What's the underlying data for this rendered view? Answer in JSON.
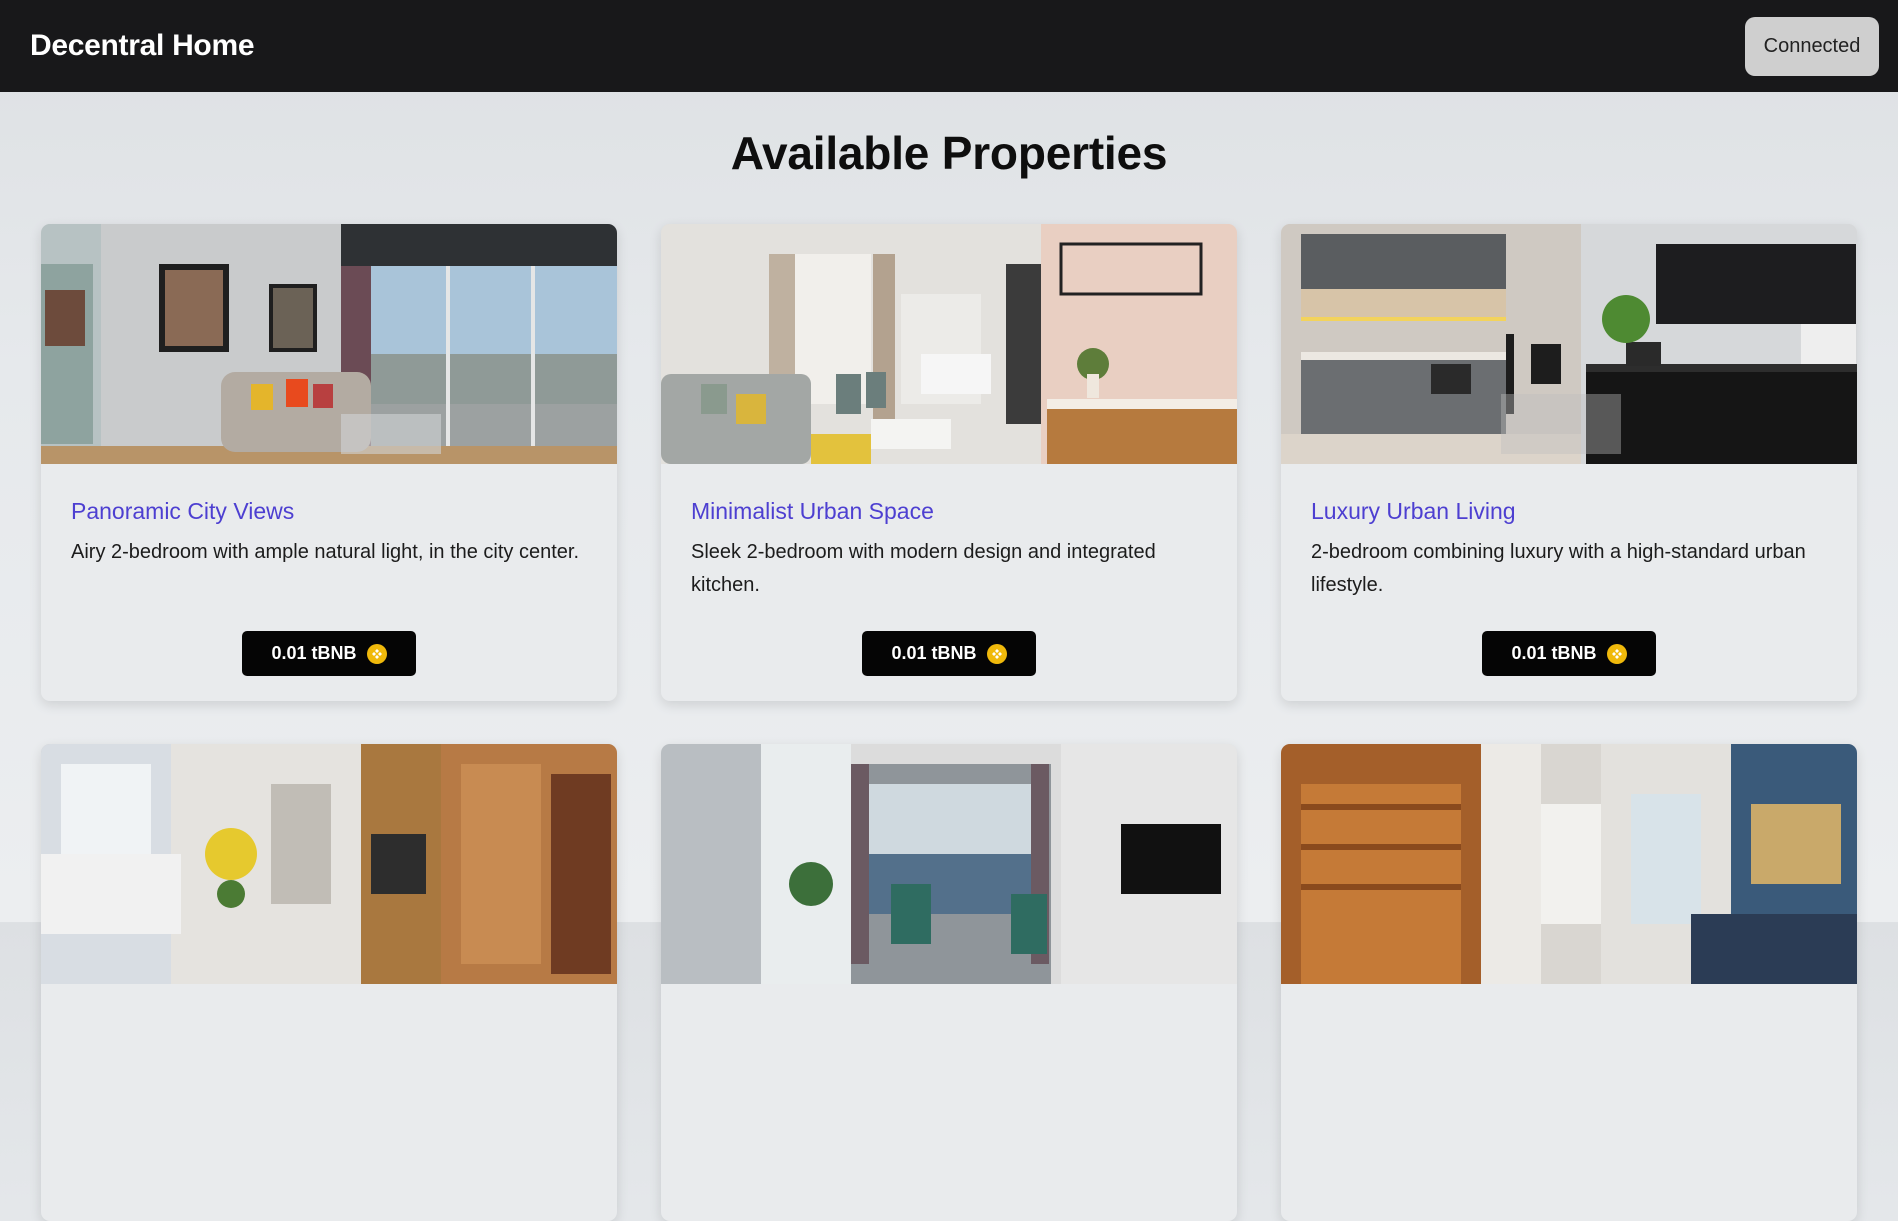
{
  "header": {
    "brand": "Decentral Home",
    "wallet_button": "Connected"
  },
  "main": {
    "title": "Available Properties"
  },
  "properties": [
    {
      "title": "Panoramic City Views",
      "description": "Airy 2-bedroom with ample natural light, in the city center.",
      "price": "0.01 tBNB",
      "image": "living-room-city-view"
    },
    {
      "title": "Minimalist Urban Space",
      "description": "Sleek 2-bedroom with modern design and integrated kitchen.",
      "price": "0.01 tBNB",
      "image": "minimalist-living-kitchen"
    },
    {
      "title": "Luxury Urban Living",
      "description": "2-bedroom combining luxury with a high-standard urban lifestyle.",
      "price": "0.01 tBNB",
      "image": "kitchen-tv-lounge"
    },
    {
      "title": "",
      "description": "",
      "price": "",
      "image": "bedroom-sauna"
    },
    {
      "title": "",
      "description": "",
      "price": "",
      "image": "sea-view-living"
    },
    {
      "title": "",
      "description": "",
      "price": "",
      "image": "sauna-living-mural"
    }
  ],
  "colors": {
    "navbar": "#18181a",
    "title_link": "#4d3fd1",
    "price_button": "#050505",
    "coin": "#f0b90b"
  },
  "icons": {
    "coin": "bnb-coin-icon"
  }
}
